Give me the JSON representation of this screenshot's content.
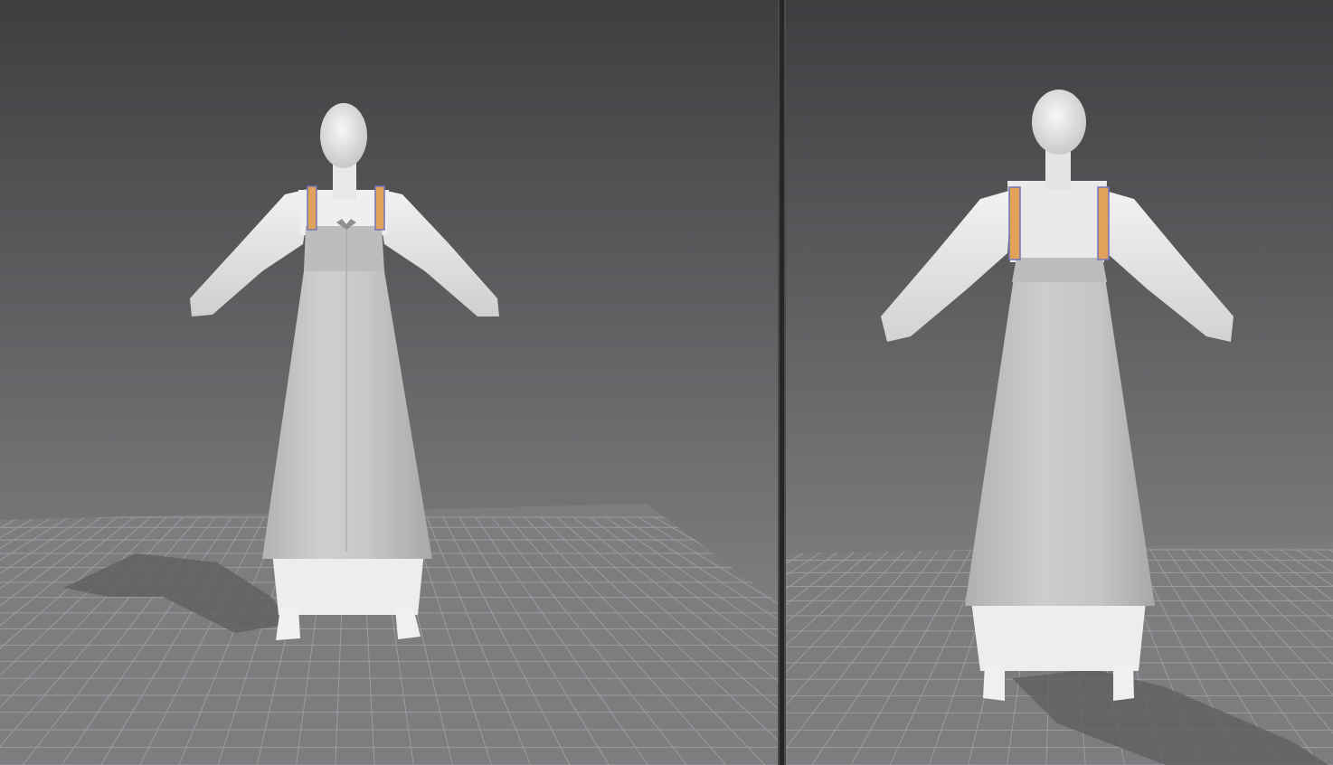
{
  "app": {
    "views": [
      {
        "id": "front",
        "label": ""
      },
      {
        "id": "back",
        "label": ""
      }
    ]
  },
  "scene": {
    "background_top": "#3e3d40",
    "background_bottom": "#8e8e90",
    "floor_color": "#7d7d80",
    "grid_line_color": "#9b9b9e",
    "avatar_color": "#e6e6e6",
    "dress_color": "#c4c4c4",
    "underdress_color": "#eeeeee",
    "strap_color": "#e0a15a",
    "strap_edge_color": "#7474b8"
  },
  "icons": {
    "avatar_front": "avatar-front-icon",
    "avatar_back": "avatar-back-icon"
  }
}
